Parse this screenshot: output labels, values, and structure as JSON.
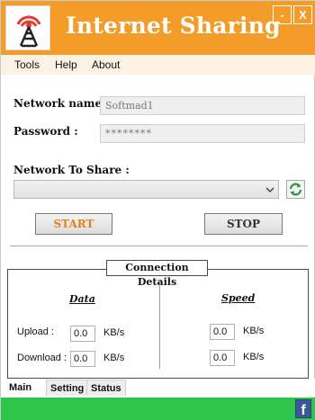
{
  "window": {
    "title": "Internet Sharing",
    "minimize_label": "-",
    "close_label": "X",
    "icon": "wifi-tower-icon",
    "accent_color": "#f39c2a"
  },
  "menu": {
    "items": [
      {
        "label": "Tools"
      },
      {
        "label": "Help"
      },
      {
        "label": "About"
      }
    ]
  },
  "form": {
    "network_name_label": "Network name :",
    "network_name_value": "Softmad1",
    "password_label": "Password :",
    "password_value": "********",
    "share_label": "Network To Share :",
    "share_selected": "",
    "refresh_icon": "refresh-icon"
  },
  "buttons": {
    "start_label": "START",
    "stop_label": "STOP"
  },
  "details": {
    "title": "Connection Details",
    "data_header": "Data",
    "speed_header": "Speed",
    "upload_label": "Upload  :",
    "download_label": "Download :",
    "upload_data": "0.0",
    "download_data": "0.0",
    "upload_speed": "0.0",
    "download_speed": "0.0",
    "unit": "KB/s"
  },
  "tabs": [
    {
      "label": "Main"
    },
    {
      "label": "Setting"
    },
    {
      "label": "Status"
    }
  ],
  "footer": {
    "facebook_label": "f",
    "footer_color": "#2ec54a"
  }
}
